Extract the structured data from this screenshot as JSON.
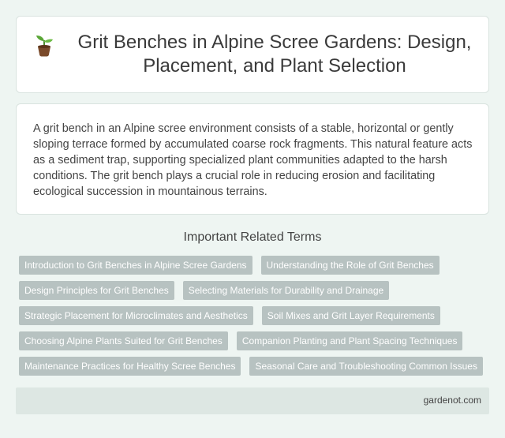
{
  "header": {
    "icon": "sprout-icon",
    "title": "Grit Benches in Alpine Scree Gardens: Design, Placement, and Plant Selection"
  },
  "description": "A grit bench in an Alpine scree environment consists of a stable, horizontal or gently sloping terrace formed by accumulated coarse rock fragments. This natural feature acts as a sediment trap, supporting specialized plant communities adapted to the harsh conditions. The grit bench plays a crucial role in reducing erosion and facilitating ecological succession in mountainous terrains.",
  "related": {
    "heading": "Important Related Terms",
    "terms": [
      "Introduction to Grit Benches in Alpine Scree Gardens",
      "Understanding the Role of Grit Benches",
      "Design Principles for Grit Benches",
      "Selecting Materials for Durability and Drainage",
      "Strategic Placement for Microclimates and Aesthetics",
      "Soil Mixes and Grit Layer Requirements",
      "Choosing Alpine Plants Suited for Grit Benches",
      "Companion Planting and Plant Spacing Techniques",
      "Maintenance Practices for Healthy Scree Benches",
      "Seasonal Care and Troubleshooting Common Issues"
    ]
  },
  "footer": {
    "site": "gardenot.com"
  },
  "colors": {
    "background": "#eef5f2",
    "tag": "#b7c2c1",
    "footer": "#dde7e3"
  }
}
